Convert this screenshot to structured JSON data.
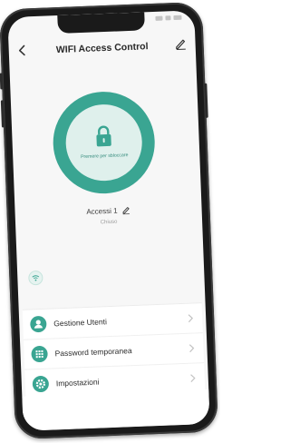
{
  "header": {
    "title": "WIFI Access Control"
  },
  "lock": {
    "hint": "Premere per sbloccare"
  },
  "device": {
    "name": "Accessi 1",
    "state": "Chiuso"
  },
  "menu": {
    "items": [
      {
        "label": "Gestione Utenti",
        "icon": "user-icon"
      },
      {
        "label": "Password temporanea",
        "icon": "keypad-icon"
      },
      {
        "label": "Impostazioni",
        "icon": "gear-icon"
      }
    ]
  },
  "colors": {
    "accent": "#3aa592",
    "accent_light": "#dff0ec",
    "phone_frame": "#1a1a1a"
  }
}
